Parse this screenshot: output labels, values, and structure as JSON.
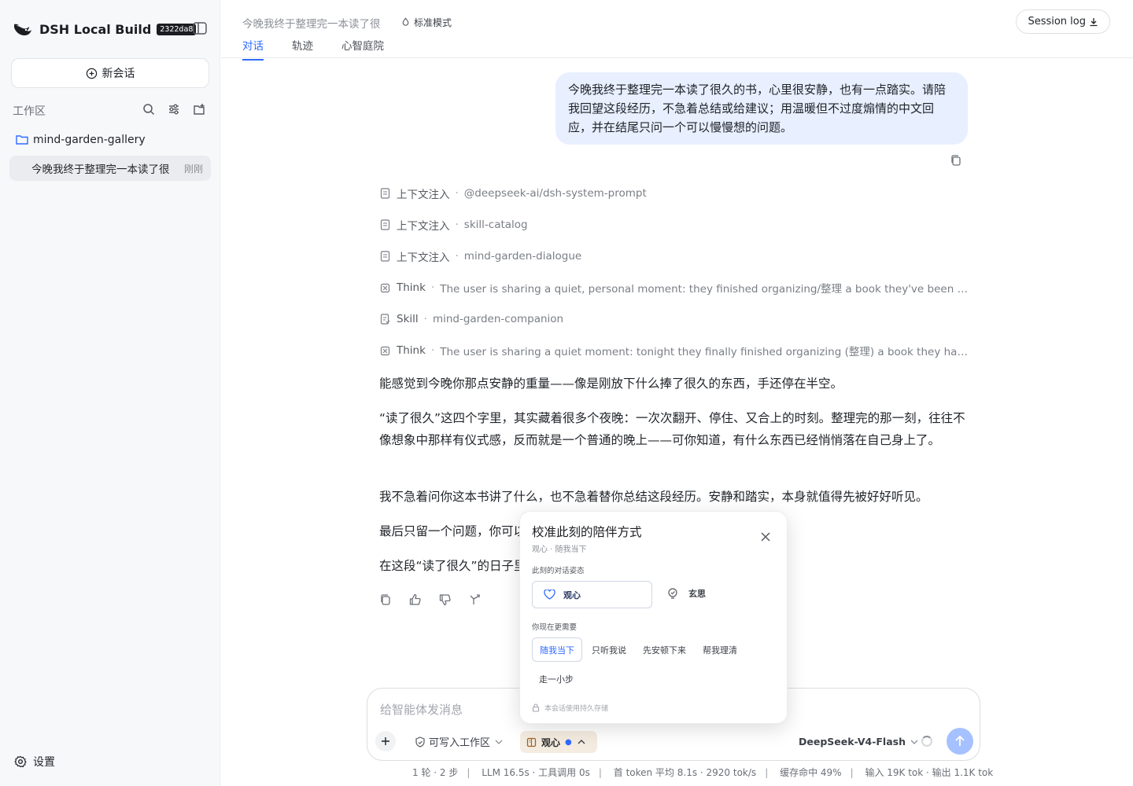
{
  "app": {
    "name": "DSH Local Build",
    "build_hash": "2322da8",
    "new_chat_label": "新会话",
    "workspace_label": "工作区",
    "folder_name": "mind-garden-gallery",
    "session_title": "今晚我终于整理完一本读了很",
    "session_time": "刚刚",
    "settings_label": "设置"
  },
  "header": {
    "title": "今晚我终于整理完一本读了很",
    "mode": "标准模式",
    "tabs": [
      {
        "label": "对话",
        "active": true
      },
      {
        "label": "轨迹",
        "active": false
      },
      {
        "label": "心智庭院",
        "active": false
      }
    ],
    "session_log_label": "Session log"
  },
  "chat": {
    "user_message": "今晚我终于整理完一本读了很久的书，心里很安静，也有一点踏实。请陪我回望这段经历，不急着总结或给建议；用温暖但不过度煽情的中文回应，并在结尾只问一个可以慢慢想的问题。",
    "trace": [
      {
        "kind": "上下文注入",
        "detail": "@deepseek-ai/dsh-system-prompt",
        "icon": "doc-icon"
      },
      {
        "kind": "上下文注入",
        "detail": "skill-catalog",
        "icon": "doc-icon"
      },
      {
        "kind": "上下文注入",
        "detail": "mind-garden-dialogue",
        "icon": "doc-icon"
      },
      {
        "kind": "Think",
        "detail": "The user is sharing a quiet, personal moment: they finished organizing/整理 a book they've been reading fo...",
        "icon": "think-icon"
      },
      {
        "kind": "Skill",
        "detail": "mind-garden-companion",
        "icon": "skill-icon"
      },
      {
        "kind": "Think",
        "detail": "The user is sharing a quiet moment: tonight they finally finished organizing (整理) a book they had been re...",
        "icon": "think-icon"
      }
    ],
    "answer": [
      "能感觉到今晚你那点安静的重量——像是刚放下什么捧了很久的东西，手还停在半空。",
      "“读了很久”这四个字里，其实藏着很多个夜晚：一次次翻开、停住、又合上的时刻。整理完的那一刻，往往不像想象中那样有仪式感，反而就是一个普通的晚上——可你知道，有什么东西已经悄悄落在自己身上了。",
      "我不急着问你这本书讲了什么，也不急着替你总结这段经历。安静和踏实，本身就值得先被好好听见。",
      "最后只留一个问题，你可以",
      "在这段“读了很久”的日子里，有没有哪一个时刻，恰好接住了你?"
    ]
  },
  "composer": {
    "placeholder": "给智能体发消息",
    "writable_label": "可写入工作区",
    "mode_label": "观心",
    "model_label": "DeepSeek-V4-Flash"
  },
  "stats": [
    "1 轮 · 2 步",
    "LLM 16.5s · 工具调用 0s",
    "首 token 平均 8.1s · 2920 tok/s",
    "缓存命中 49%",
    "输入 19K tok · 输出 1.1K tok"
  ],
  "popover": {
    "title": "校准此刻的陪伴方式",
    "subtitle": "观心 · 随我当下",
    "section1": "此刻的对话姿态",
    "stance_a": "观心",
    "stance_b": "玄思",
    "section2": "你现在更需要",
    "needs": [
      "随我当下",
      "只听我说",
      "先安顿下来",
      "帮我理清"
    ],
    "need_extra": "走一小步",
    "footer": "本会话使用持久存储"
  },
  "colors": {
    "accent": "#2f6bff",
    "user_bubble": "#e8efff",
    "mode_pill": "#f4ece0",
    "send": "#a6c1ff"
  }
}
